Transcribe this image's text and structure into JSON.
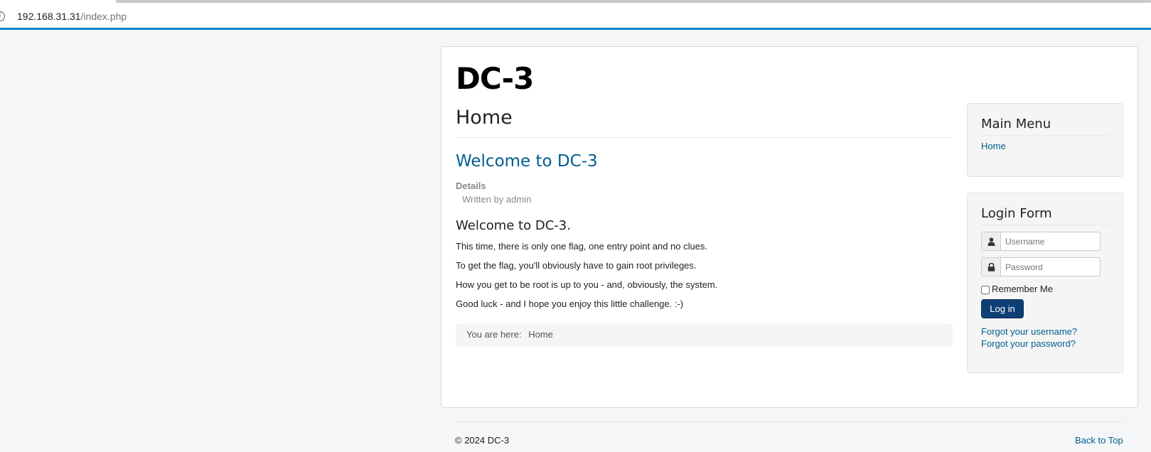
{
  "browser": {
    "url_host": "192.168.31.31",
    "url_path": "/index.php",
    "info_icon": "info-icon"
  },
  "site": {
    "brand": "DC-3"
  },
  "article": {
    "page_heading": "Home",
    "title": "Welcome to DC-3",
    "details_label": "Details",
    "written_by": "Written by admin",
    "subheading": "Welcome to DC-3.",
    "paragraphs": [
      "This time, there is only one flag, one entry point and no clues.",
      "To get the flag, you'll obviously have to gain root privileges.",
      "How you get to be root is up to you - and, obviously, the system.",
      "Good luck - and I hope you enjoy this little challenge.  :-)"
    ]
  },
  "breadcrumb": {
    "prefix": "You are here:",
    "current": "Home"
  },
  "main_menu": {
    "title": "Main Menu",
    "items": [
      "Home"
    ]
  },
  "login_form": {
    "title": "Login Form",
    "username_placeholder": "Username",
    "password_placeholder": "Password",
    "remember_label": "Remember Me",
    "remember_checked": false,
    "login_button": "Log in",
    "forgot_username": "Forgot your username?",
    "forgot_password": "Forgot your password?",
    "user_icon": "user-icon",
    "lock_icon": "lock-icon"
  },
  "footer": {
    "copyright": "© 2024 DC-3",
    "back_to_top": "Back to Top"
  },
  "colors": {
    "accent_link": "#005e8d",
    "button": "#0d3f75",
    "address_bar_underline": "#0088cc"
  }
}
